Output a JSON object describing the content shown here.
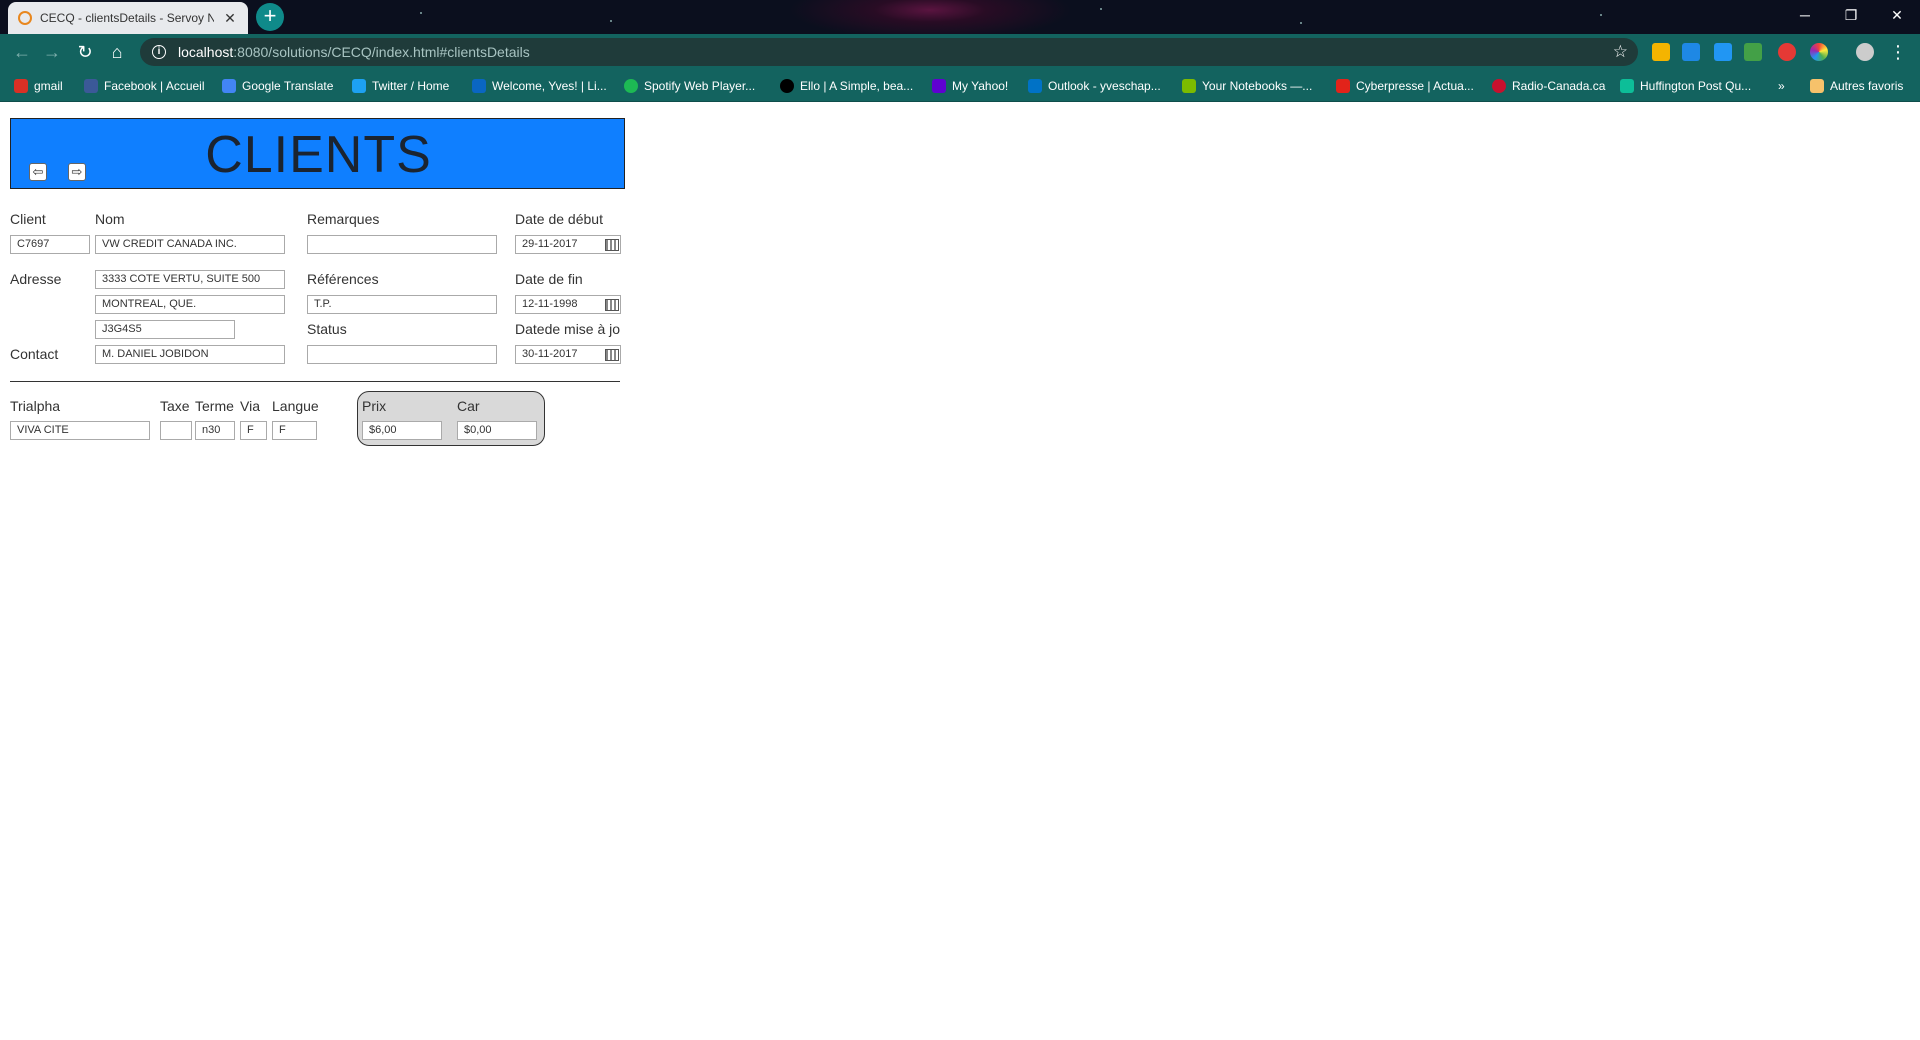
{
  "browser": {
    "tab_title": "CECQ - clientsDetails - Servoy NG",
    "new_tab": "+",
    "url_host": "localhost",
    "url_rest": ":8080/solutions/CECQ/index.html#clientsDetails",
    "bookmarks": [
      {
        "label": "gmail",
        "color": "#d93025"
      },
      {
        "label": "Facebook | Accueil",
        "color": "#3b5998"
      },
      {
        "label": "Google Translate",
        "color": "#4285f4"
      },
      {
        "label": "Twitter / Home",
        "color": "#1da1f2"
      },
      {
        "label": "Welcome, Yves! | Li...",
        "color": "#0a66c2"
      },
      {
        "label": "Spotify Web Player...",
        "color": "#1db954"
      },
      {
        "label": "Ello | A Simple, bea...",
        "color": "#000000"
      },
      {
        "label": "My Yahoo!",
        "color": "#5f01d1"
      },
      {
        "label": "Outlook - yveschap...",
        "color": "#0072c6"
      },
      {
        "label": "Your Notebooks —...",
        "color": "#7cbb00"
      },
      {
        "label": "Cyberpresse | Actua...",
        "color": "#e2231a"
      },
      {
        "label": "Radio-Canada.ca",
        "color": "#c8102e"
      },
      {
        "label": "Huffington Post Qu...",
        "color": "#0dbe98"
      }
    ],
    "more_bookmarks": "»",
    "other_bookmarks": "Autres favoris"
  },
  "form": {
    "title": "CLIENTS",
    "labels": {
      "client": "Client",
      "nom": "Nom",
      "remarques": "Remarques",
      "date_debut": "Date de début",
      "adresse": "Adresse",
      "references": "Références",
      "date_fin": "Date de fin",
      "status": "Status",
      "date_maj": "Datede mise à jo",
      "contact": "Contact",
      "trialpha": "Trialpha",
      "taxe": "Taxe",
      "terme": "Terme",
      "via": "Via",
      "langue": "Langue",
      "prix": "Prix",
      "car": "Car"
    },
    "values": {
      "client": "C7697",
      "nom": "VW CREDIT CANADA INC.",
      "remarques": "",
      "date_debut": "29-11-2017",
      "adresse1": "3333 COTE VERTU, SUITE 500",
      "adresse2": "MONTREAL, QUE.",
      "adresse3": "J3G4S5",
      "references": "T.P.",
      "date_fin": "12-11-1998",
      "status": "",
      "date_maj": "30-11-2017",
      "contact": "M. DANIEL JOBIDON",
      "trialpha": "VIVA CITE",
      "taxe": "",
      "terme": "n30",
      "via": "F",
      "langue": "F",
      "prix": "$6,00",
      "car": "$0,00"
    }
  }
}
